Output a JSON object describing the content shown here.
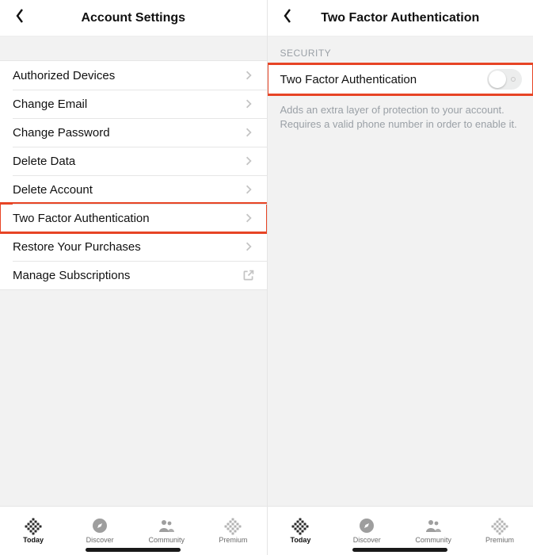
{
  "left": {
    "title": "Account Settings",
    "items": [
      {
        "label": "Authorized Devices",
        "accessory": "chevron",
        "highlight": false
      },
      {
        "label": "Change Email",
        "accessory": "chevron",
        "highlight": false
      },
      {
        "label": "Change Password",
        "accessory": "chevron",
        "highlight": false
      },
      {
        "label": "Delete Data",
        "accessory": "chevron",
        "highlight": false
      },
      {
        "label": "Delete Account",
        "accessory": "chevron",
        "highlight": false
      },
      {
        "label": "Two Factor Authentication",
        "accessory": "chevron",
        "highlight": true
      },
      {
        "label": "Restore Your Purchases",
        "accessory": "chevron",
        "highlight": false
      },
      {
        "label": "Manage Subscriptions",
        "accessory": "external",
        "highlight": false
      }
    ]
  },
  "right": {
    "title": "Two Factor Authentication",
    "section": "SECURITY",
    "row_label": "Two Factor Authentication",
    "toggle_on": false,
    "hint": "Adds an extra layer of protection to your account. Requires a valid phone number in order to enable it."
  },
  "tabs": [
    {
      "label": "Today",
      "icon": "fitbit",
      "active": true
    },
    {
      "label": "Discover",
      "icon": "compass",
      "active": false
    },
    {
      "label": "Community",
      "icon": "people",
      "active": false
    },
    {
      "label": "Premium",
      "icon": "fitbit-dim",
      "active": false
    }
  ]
}
